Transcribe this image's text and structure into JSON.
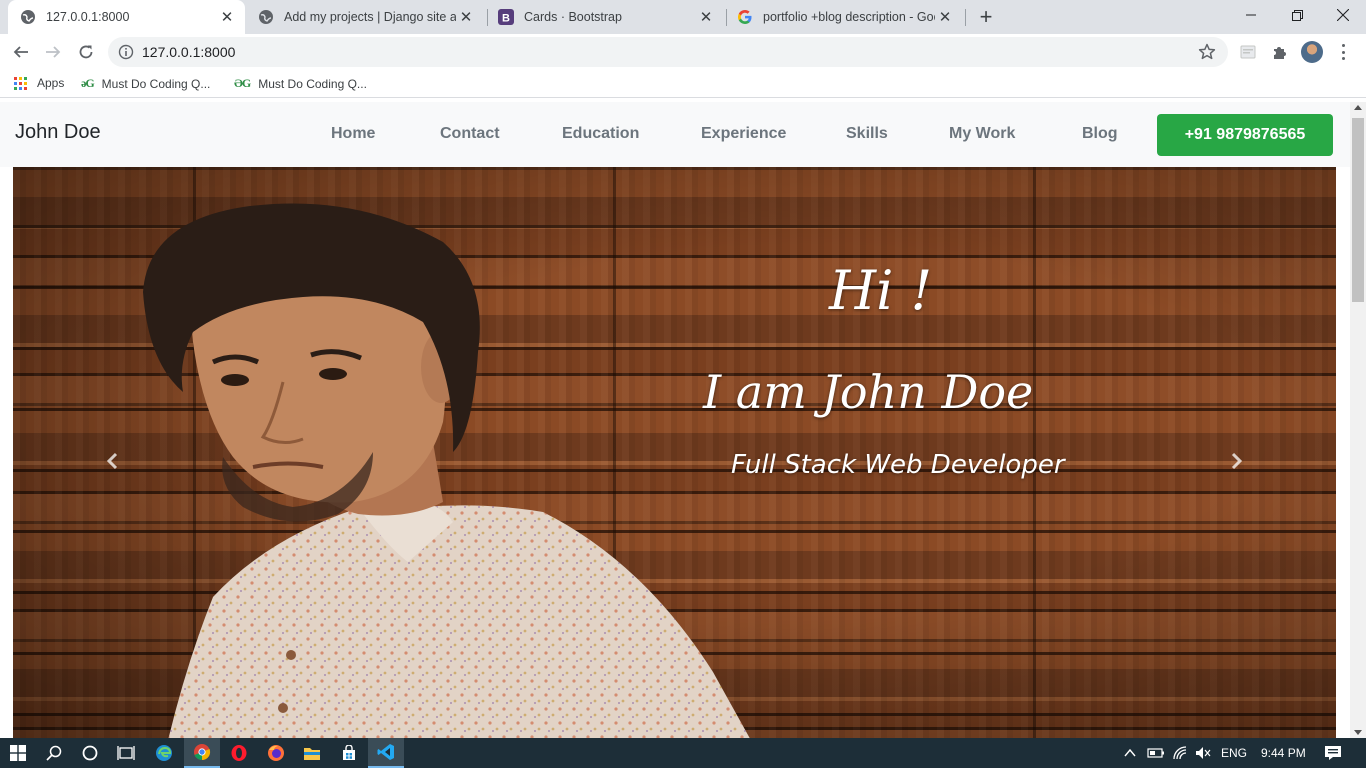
{
  "browser": {
    "tabs": [
      {
        "title": "127.0.0.1:8000",
        "icon": "globe-icon",
        "active": true
      },
      {
        "title": "Add my projects | Django site ad",
        "icon": "globe-icon",
        "active": false
      },
      {
        "title": "Cards · Bootstrap",
        "icon": "bootstrap-icon",
        "active": false
      },
      {
        "title": "portfolio +blog description - Goo",
        "icon": "google-icon",
        "active": false
      }
    ],
    "url": "127.0.0.1:8000",
    "bookmarks": [
      {
        "label": "Apps",
        "icon": "apps-grid-icon"
      },
      {
        "label": "Must Do Coding Q...",
        "icon": "gfg-icon",
        "icon_text": "ǝG"
      },
      {
        "label": "Must Do Coding Q...",
        "icon": "gfg-icon",
        "icon_text": "ƏG"
      }
    ]
  },
  "site": {
    "brand": "John Doe",
    "nav": [
      "Home",
      "Contact",
      "Education",
      "Experience",
      "Skills",
      "My Work",
      "Blog"
    ],
    "phone": "+91 9879876565",
    "hero": {
      "greeting": "Hi !",
      "headline": "I am John Doe",
      "role": "Full Stack Web Developer"
    }
  },
  "taskbar": {
    "apps": [
      "windows-start-icon",
      "search-icon",
      "cortana-icon",
      "task-view-icon",
      "edge-icon",
      "chrome-icon",
      "opera-icon",
      "firefox-icon",
      "file-explorer-icon",
      "store-icon",
      "vscode-icon"
    ],
    "lang": "ENG",
    "time": "9:44 PM"
  },
  "colors": {
    "accent_green": "#28a745",
    "nav_bg": "#f8f9fa",
    "taskbar": "#1d2e38"
  }
}
